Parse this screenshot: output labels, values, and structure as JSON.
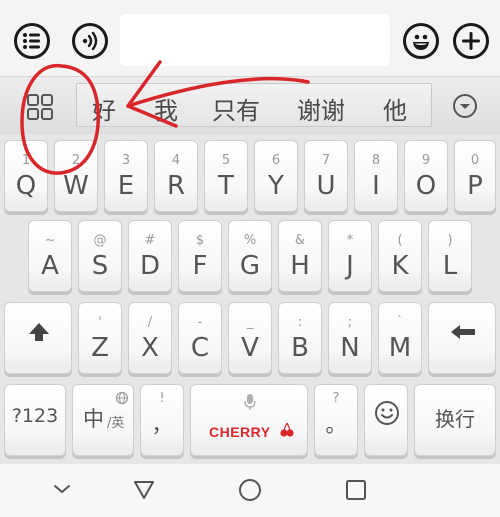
{
  "icons": {
    "list_button": "list-icon",
    "voice_button": "voice-waves-icon",
    "emoji_button": "smiley-icon",
    "add_button": "plus-icon",
    "grid_button": "grid-icon",
    "expand_button": "chevron-down-icon",
    "shift_key": "shift-up-arrow-icon",
    "backspace_key": "backspace-arrow-icon",
    "mic_hint": "microphone-icon",
    "globe_hint": "globe-icon",
    "emoji_key": "smiley-icon",
    "cherry_logo": "cherry-fruit-icon",
    "nav_back": "triangle-back-icon",
    "nav_home": "circle-home-icon",
    "nav_recents": "square-recents-icon",
    "nav_hide": "chevron-down-icon"
  },
  "colors": {
    "annotation_red": "#d9262b",
    "cherry_brand": "#d9262b"
  },
  "chat": {
    "input_value": ""
  },
  "candidates": [
    "好",
    "我",
    "只有",
    "谢谢",
    "他"
  ],
  "keyboard": {
    "row1": [
      {
        "hint": "1",
        "label": "Q"
      },
      {
        "hint": "2",
        "label": "W"
      },
      {
        "hint": "3",
        "label": "E"
      },
      {
        "hint": "4",
        "label": "R"
      },
      {
        "hint": "5",
        "label": "T"
      },
      {
        "hint": "6",
        "label": "Y"
      },
      {
        "hint": "7",
        "label": "U"
      },
      {
        "hint": "8",
        "label": "I"
      },
      {
        "hint": "9",
        "label": "O"
      },
      {
        "hint": "0",
        "label": "P"
      }
    ],
    "row2": [
      {
        "hint": "~",
        "label": "A"
      },
      {
        "hint": "@",
        "label": "S"
      },
      {
        "hint": "#",
        "label": "D"
      },
      {
        "hint": "$",
        "label": "F"
      },
      {
        "hint": "%",
        "label": "G"
      },
      {
        "hint": "&",
        "label": "H"
      },
      {
        "hint": "*",
        "label": "J"
      },
      {
        "hint": "(",
        "label": "K"
      },
      {
        "hint": ")",
        "label": "L"
      }
    ],
    "row3": [
      {
        "hint": "'",
        "label": "Z"
      },
      {
        "hint": "/",
        "label": "X"
      },
      {
        "hint": "-",
        "label": "C"
      },
      {
        "hint": "_",
        "label": "V"
      },
      {
        "hint": ":",
        "label": "B"
      },
      {
        "hint": ";",
        "label": "N"
      },
      {
        "hint": "`",
        "label": "M"
      }
    ],
    "row4": {
      "numbers": "?123",
      "lang_main": "中",
      "lang_sub": "/英",
      "punct_hint": "!",
      "punct_main": "，",
      "space_brand": "CHERRY",
      "period_hint": "?",
      "period_main": "。",
      "enter": "换行"
    }
  }
}
